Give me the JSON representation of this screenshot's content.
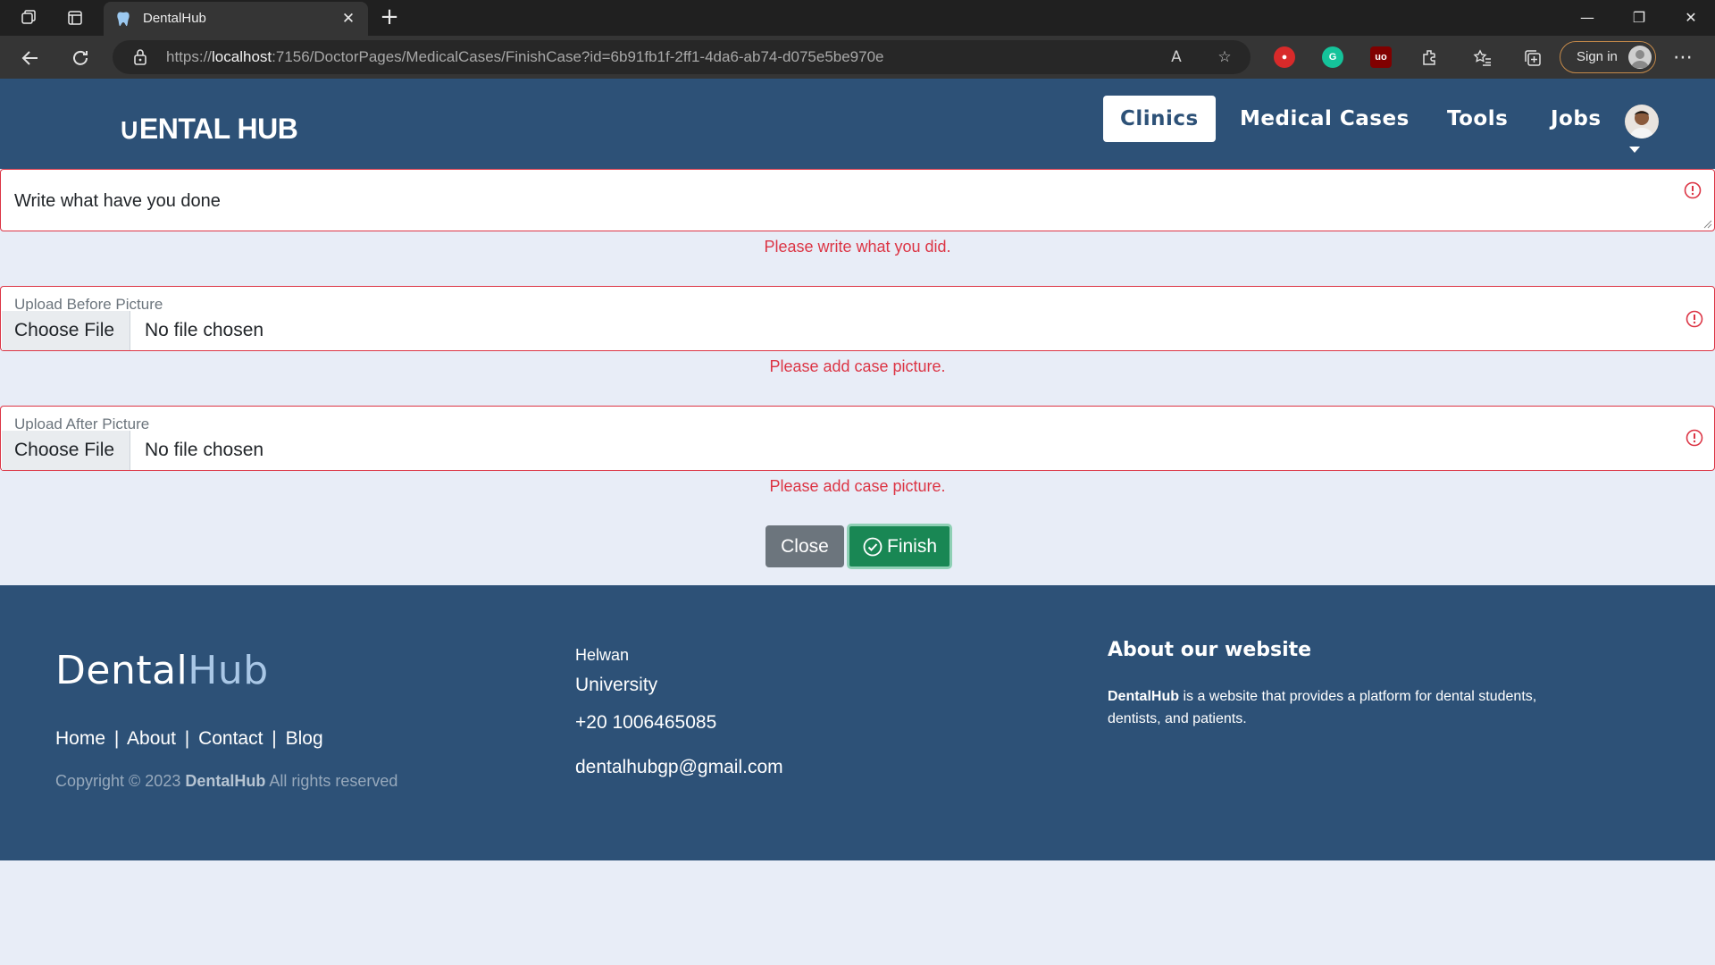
{
  "browser": {
    "tab_title": "DentalHub",
    "url_prefix": "https://",
    "url_host": "localhost",
    "url_rest": ":7156/DoctorPages/MedicalCases/FinishCase?id=6b91fb1f-2ff1-4da6-ab74-d075e5be970e",
    "signin_label": "Sign in"
  },
  "header": {
    "logo": "∪ENTAL HUB",
    "nav": [
      "Clinics",
      "Medical Cases",
      "Tools",
      "Jobs"
    ],
    "active_nav": "Clinics"
  },
  "form": {
    "done_placeholder": "Write what have you done",
    "done_error": "Please write what you did.",
    "before_label": "Upload Before Picture",
    "after_label": "Upload After Picture",
    "choose_file": "Choose File",
    "no_file": "No file chosen",
    "picture_error": "Please add case picture.",
    "close_label": "Close",
    "finish_label": "Finish"
  },
  "footer": {
    "brand_dental": "Dental",
    "brand_hub": "Hub",
    "links": [
      "Home",
      "About",
      "Contact",
      "Blog"
    ],
    "link_separator": "|",
    "copyright_prefix": "Copyright © 2023 ",
    "copyright_brand": "DentalHub",
    "copyright_suffix": " All rights reserved",
    "city": "Helwan",
    "university": "University",
    "phone": "+20 1006465085",
    "email": "dentalhubgp@gmail.com",
    "about_heading": "About our website",
    "about_brand": "DentalHub",
    "about_text": " is a website that provides a platform for dental students, dentists, and patients."
  },
  "colors": {
    "brand_blue": "#2d5177",
    "error_red": "#dc3545",
    "finish_green": "#198754",
    "close_gray": "#6c757d",
    "page_bg": "#e8edf7"
  }
}
